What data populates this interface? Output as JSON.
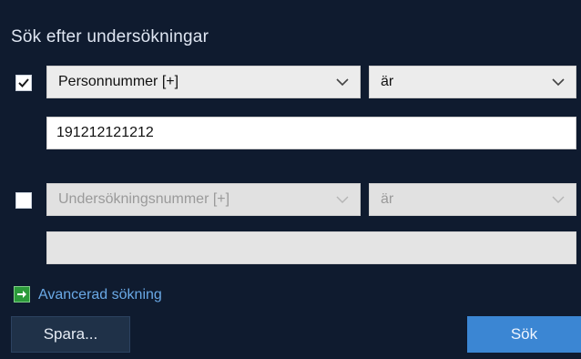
{
  "dialog": {
    "title": "Sök efter undersökningar"
  },
  "criteria": [
    {
      "enabled": true,
      "field_label": "Personnummer [+]",
      "operator_label": "är",
      "value": "191212121212",
      "placeholder": ""
    },
    {
      "enabled": false,
      "field_label": "Undersökningsnummer [+]",
      "operator_label": "är",
      "value": "",
      "placeholder": ""
    }
  ],
  "advanced": {
    "label": "Avancerad sökning",
    "icon": "arrow-right-icon",
    "icon_color": "#2b9a3a"
  },
  "buttons": {
    "save_label": "Spara...",
    "search_label": "Sök"
  },
  "colors": {
    "background": "#0f1b2f",
    "primary": "#3b86d3",
    "link": "#6aa9e6"
  }
}
